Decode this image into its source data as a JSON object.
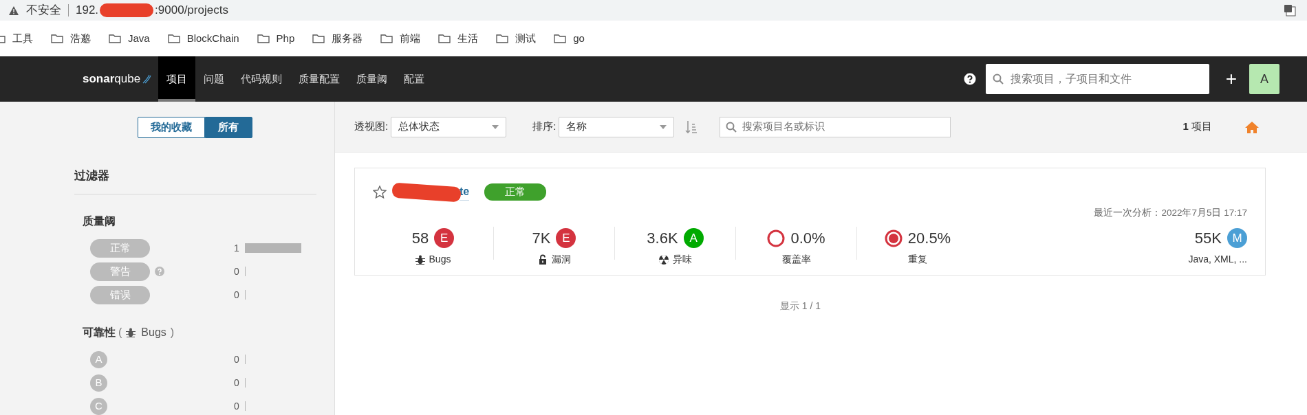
{
  "browser": {
    "security_text": "不安全",
    "url_parts": [
      "192.",
      ":9000/projects"
    ]
  },
  "bookmarks": [
    "工具",
    "浩邈",
    "Java",
    "BlockChain",
    "Php",
    "服务器",
    "前端",
    "生活",
    "测试",
    "go"
  ],
  "navbar": {
    "logo": "**sonar**qube",
    "items": [
      {
        "label": "项目",
        "selected": true
      },
      {
        "label": "问题",
        "selected": false
      },
      {
        "label": "代码规则",
        "selected": false
      },
      {
        "label": "质量配置",
        "selected": false
      },
      {
        "label": "质量阈",
        "selected": false
      },
      {
        "label": "配置",
        "selected": false
      }
    ],
    "search": {
      "placeholder": "搜索项目，子项目和文件"
    },
    "add": "+",
    "avatar": "A"
  },
  "sidebar": {
    "toggle": [
      {
        "label": "我的收藏",
        "selected": false
      },
      {
        "label": "所有",
        "selected": true
      }
    ],
    "filters_title": "过滤器",
    "facets": [
      {
        "title": "质量阈",
        "options": [
          {
            "kind": "pill",
            "label": "正常",
            "help": false,
            "count": "1"
          },
          {
            "kind": "pill",
            "label": "警告",
            "help": true,
            "count": "0"
          },
          {
            "kind": "pill",
            "label": "错误",
            "help": false,
            "count": "0"
          }
        ]
      },
      {
        "title": "可靠性",
        "bracket_open": "(",
        "subtitle": "Bugs",
        "bracket_close": ")",
        "options": [
          {
            "kind": "rating",
            "label": "A",
            "help": false,
            "count": "0"
          },
          {
            "kind": "rating",
            "label": "B",
            "help": false,
            "count": "0"
          },
          {
            "kind": "rating",
            "label": "C",
            "help": false,
            "count": "0"
          }
        ]
      }
    ]
  },
  "toolbar": {
    "perspective_label": "透视图:",
    "perspective_value": "总体状态",
    "sort_label": "排序:",
    "sort_value": "名称",
    "search": {
      "placeholder": "搜索项目名或标识"
    },
    "count": "**1** 项目"
  },
  "project": {
    "name": "te",
    "favorite": false,
    "gate": "正常",
    "last_analysis": "最近一次分析：2022年7月5日 17:17",
    "measures": [
      {
        "kind": "bugs",
        "value": "58",
        "rating": "E",
        "color": "#d4333f",
        "label": "Bugs"
      },
      {
        "kind": "vulnerabilities",
        "value": "7K",
        "rating": "E",
        "color": "#d4333f",
        "label": "漏洞"
      },
      {
        "kind": "code_smells",
        "value": "3.6K",
        "rating": "A",
        "color": "#00aa00",
        "label": "异味"
      },
      {
        "kind": "coverage",
        "value": "0.0%",
        "label": "覆盖率"
      },
      {
        "kind": "duplications",
        "value": "20.5%",
        "label": "重复"
      },
      {
        "kind": "size",
        "value": "55K",
        "rating": "M",
        "color": "#4b9fd5",
        "label": "Java, XML, ..."
      }
    ]
  },
  "pagination": "显示 1 / 1"
}
